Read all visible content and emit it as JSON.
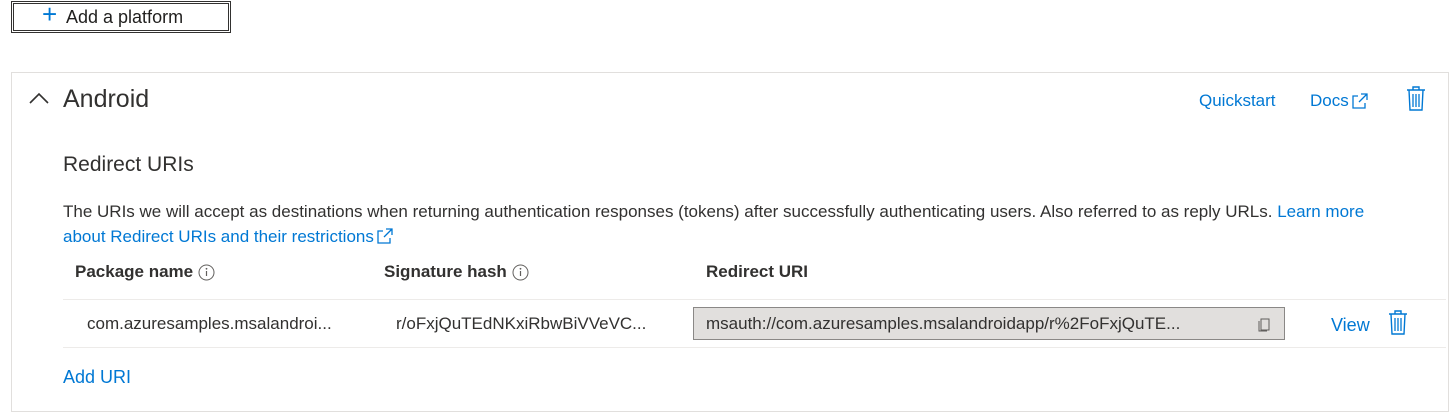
{
  "toolbar": {
    "add_platform_label": "Add a platform"
  },
  "platform": {
    "name": "Android",
    "quickstart_label": "Quickstart",
    "docs_label": "Docs"
  },
  "redirect": {
    "section_title": "Redirect URIs",
    "description": "The URIs we will accept as destinations when returning authentication responses (tokens) after successfully authenticating users. Also referred to as reply URLs.",
    "learn_more": "Learn more about Redirect URIs and their restrictions",
    "columns": {
      "package": "Package name",
      "signature": "Signature hash",
      "uri": "Redirect URI"
    },
    "rows": [
      {
        "package": "com.azuresamples.msalandroi...",
        "signature": "r/oFxjQuTEdNKxiRbwBiVVeVC...",
        "uri": "msauth://com.azuresamples.msalandroidapp/r%2FoFxjQuTE...",
        "view_label": "View"
      }
    ],
    "add_uri_label": "Add URI"
  },
  "icons": {
    "plus": "plus-icon",
    "chevron": "chevron-up-icon",
    "external": "external-link-icon",
    "delete": "trash-icon",
    "info": "info-icon",
    "copy": "copy-icon"
  },
  "colors": {
    "link": "#0078d4",
    "text": "#323130",
    "border": "#e1dfdd"
  }
}
